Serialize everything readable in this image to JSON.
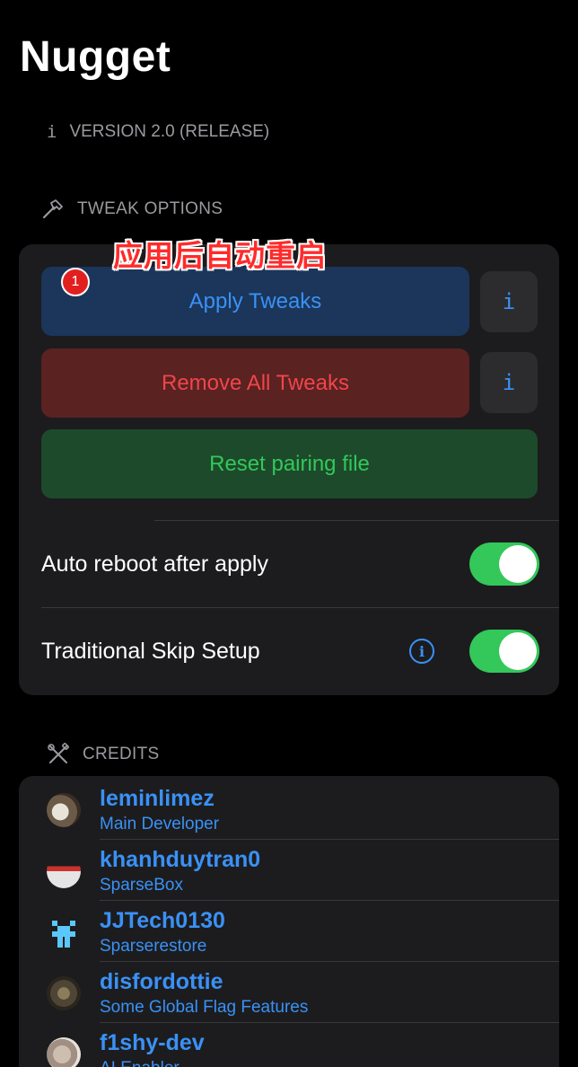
{
  "app": {
    "title": "Nugget"
  },
  "version": {
    "icon": "info-glyph",
    "text": "VERSION 2.0 (RELEASE)"
  },
  "tweak_section": {
    "header_icon": "hammer-icon",
    "header": "TWEAK OPTIONS",
    "annotation": "应用后自动重启",
    "badge": "1",
    "apply_label": "Apply Tweaks",
    "remove_label": "Remove All Tweaks",
    "reset_label": "Reset pairing file",
    "info_label": "i",
    "auto_reboot_label": "Auto reboot after apply",
    "auto_reboot_on": true,
    "skip_setup_label": "Traditional Skip Setup",
    "skip_setup_on": true,
    "skip_info_glyph": "i"
  },
  "credits": {
    "header_icon": "tools-icon",
    "header": "CREDITS",
    "items": [
      {
        "name": "leminlimez",
        "role": "Main Developer"
      },
      {
        "name": "khanhduytran0",
        "role": "SparseBox"
      },
      {
        "name": "JJTech0130",
        "role": "Sparserestore"
      },
      {
        "name": "disfordottie",
        "role": "Some Global Flag Features"
      },
      {
        "name": "f1shy-dev",
        "role": "AI Enabler"
      }
    ]
  },
  "colors": {
    "accent_blue": "#3a91f5",
    "destructive_red": "#f0454a",
    "success_green": "#32c85a",
    "toggle_green": "#34c759",
    "card_bg": "#1c1c1e"
  }
}
